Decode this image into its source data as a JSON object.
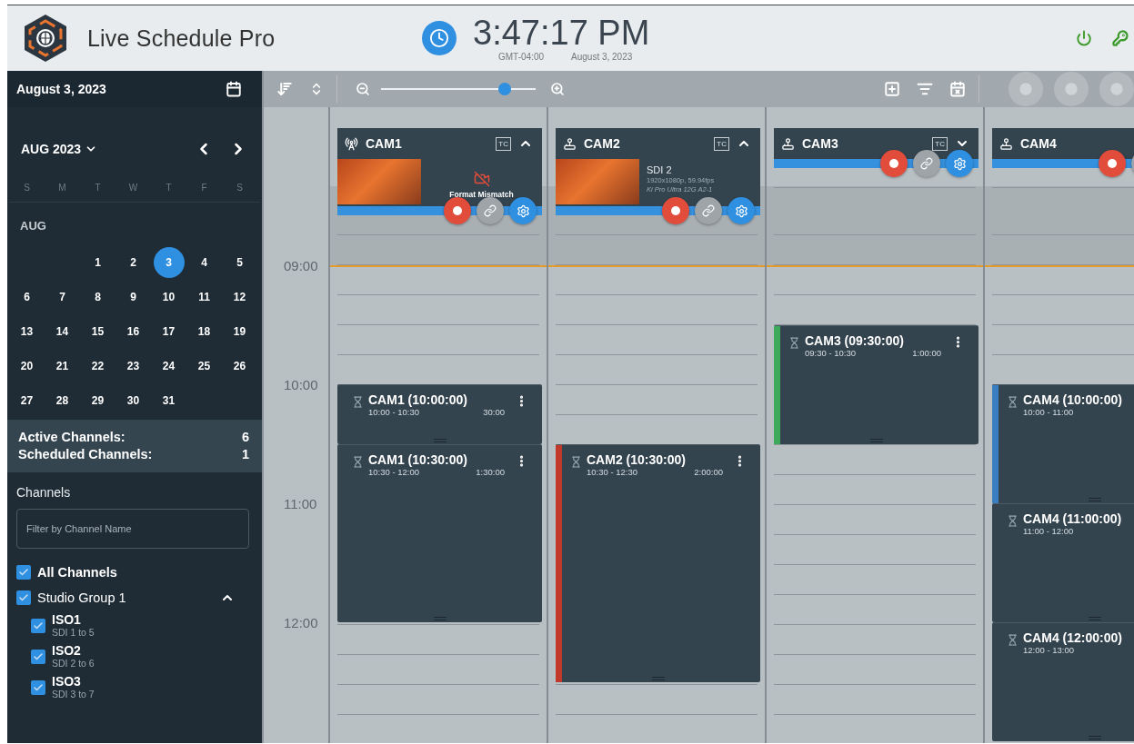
{
  "app": {
    "title": "Live Schedule Pro"
  },
  "clock": {
    "time": "3:47:17 PM",
    "timezone": "GMT-04:00",
    "date": "August 3, 2023"
  },
  "sidebar": {
    "date": "August 3, 2023",
    "calendar": {
      "month": "AUG 2023",
      "weekdays": [
        "S",
        "M",
        "T",
        "W",
        "T",
        "F",
        "S"
      ],
      "section": "AUG",
      "weeks": [
        [
          {
            "label": "1",
            "selected": false
          },
          {
            "label": "2",
            "selected": false
          },
          {
            "label": "3",
            "selected": true
          },
          {
            "label": "4",
            "selected": false
          },
          {
            "label": "5",
            "selected": false
          }
        ],
        [
          {
            "label": "6",
            "selected": false
          },
          {
            "label": "7",
            "selected": false
          },
          {
            "label": "8",
            "selected": false
          },
          {
            "label": "9",
            "selected": false
          },
          {
            "label": "10",
            "selected": false
          },
          {
            "label": "11",
            "selected": false
          },
          {
            "label": "12",
            "selected": false
          }
        ],
        [
          {
            "label": "13",
            "selected": false
          },
          {
            "label": "14",
            "selected": false
          },
          {
            "label": "15",
            "selected": false
          },
          {
            "label": "16",
            "selected": false
          },
          {
            "label": "17",
            "selected": false
          },
          {
            "label": "18",
            "selected": false
          },
          {
            "label": "19",
            "selected": false
          }
        ],
        [
          {
            "label": "20",
            "selected": false
          },
          {
            "label": "21",
            "selected": false
          },
          {
            "label": "22",
            "selected": false
          },
          {
            "label": "23",
            "selected": false
          },
          {
            "label": "24",
            "selected": false
          },
          {
            "label": "25",
            "selected": false
          },
          {
            "label": "26",
            "selected": false
          }
        ],
        [
          {
            "label": "27",
            "selected": false
          },
          {
            "label": "28",
            "selected": false
          },
          {
            "label": "29",
            "selected": false
          },
          {
            "label": "30",
            "selected": false
          },
          {
            "label": "31",
            "selected": false
          }
        ]
      ]
    },
    "stats": [
      {
        "label": "Active Channels:",
        "value": "6"
      },
      {
        "label": "Scheduled Channels:",
        "value": "1"
      }
    ],
    "channels_title": "Channels",
    "filter": {
      "placeholder": "Filter by Channel Name"
    },
    "tree": [
      {
        "label": "All Channels",
        "checked": true
      },
      {
        "label": "Studio Group 1",
        "checked": true,
        "expanded": true,
        "children": [
          {
            "label": "ISO1",
            "sublabel": "SDI 1 to 5",
            "checked": true
          },
          {
            "label": "ISO2",
            "sublabel": "SDI 2 to 6",
            "checked": true
          },
          {
            "label": "ISO3",
            "sublabel": "SDI 3 to 7",
            "checked": true
          }
        ]
      }
    ]
  },
  "toolbar": {
    "zoom": {
      "level": 0.8
    }
  },
  "timeline": {
    "hours": [
      "09:00",
      "10:00",
      "11:00",
      "12:00"
    ]
  },
  "channels": [
    {
      "name": "CAM1",
      "kind": "stream",
      "tc": "TC",
      "expanded": true,
      "preview": {
        "kind": "warning",
        "message": "Format Mismatch"
      },
      "events": [
        {
          "title": "CAM1 (10:00:00)",
          "range": "10:00 - 10:30",
          "duration": "30:00"
        },
        {
          "title": "CAM1 (10:30:00)",
          "range": "10:30 - 12:00",
          "duration": "1:30:00"
        }
      ]
    },
    {
      "name": "CAM2",
      "kind": "device",
      "tc": "TC",
      "expanded": true,
      "preview": {
        "kind": "info",
        "source": "SDI 2",
        "format": "1920x1080p, 59.94fps",
        "device": "Ki Pro Ultra 12G A2-1"
      },
      "events": [
        {
          "title": "CAM2 (10:30:00)",
          "range": "10:30 - 12:30",
          "duration": "2:00:00",
          "color": "#c0392b"
        }
      ]
    },
    {
      "name": "CAM3",
      "kind": "device",
      "tc": "TC",
      "expanded": false,
      "events": [
        {
          "title": "CAM3 (09:30:00)",
          "range": "09:30 - 10:30",
          "duration": "1:00:00",
          "color": "#3daa5a"
        }
      ]
    },
    {
      "name": "CAM4",
      "kind": "device",
      "events": [
        {
          "title": "CAM4 (10:00:00)",
          "range": "10:00 - 11:00",
          "color": "#3a7dc0"
        },
        {
          "title": "CAM4 (11:00:00)",
          "range": "11:00 - 12:00"
        },
        {
          "title": "CAM4 (12:00:00)",
          "range": "12:00 - 13:00"
        }
      ]
    }
  ]
}
